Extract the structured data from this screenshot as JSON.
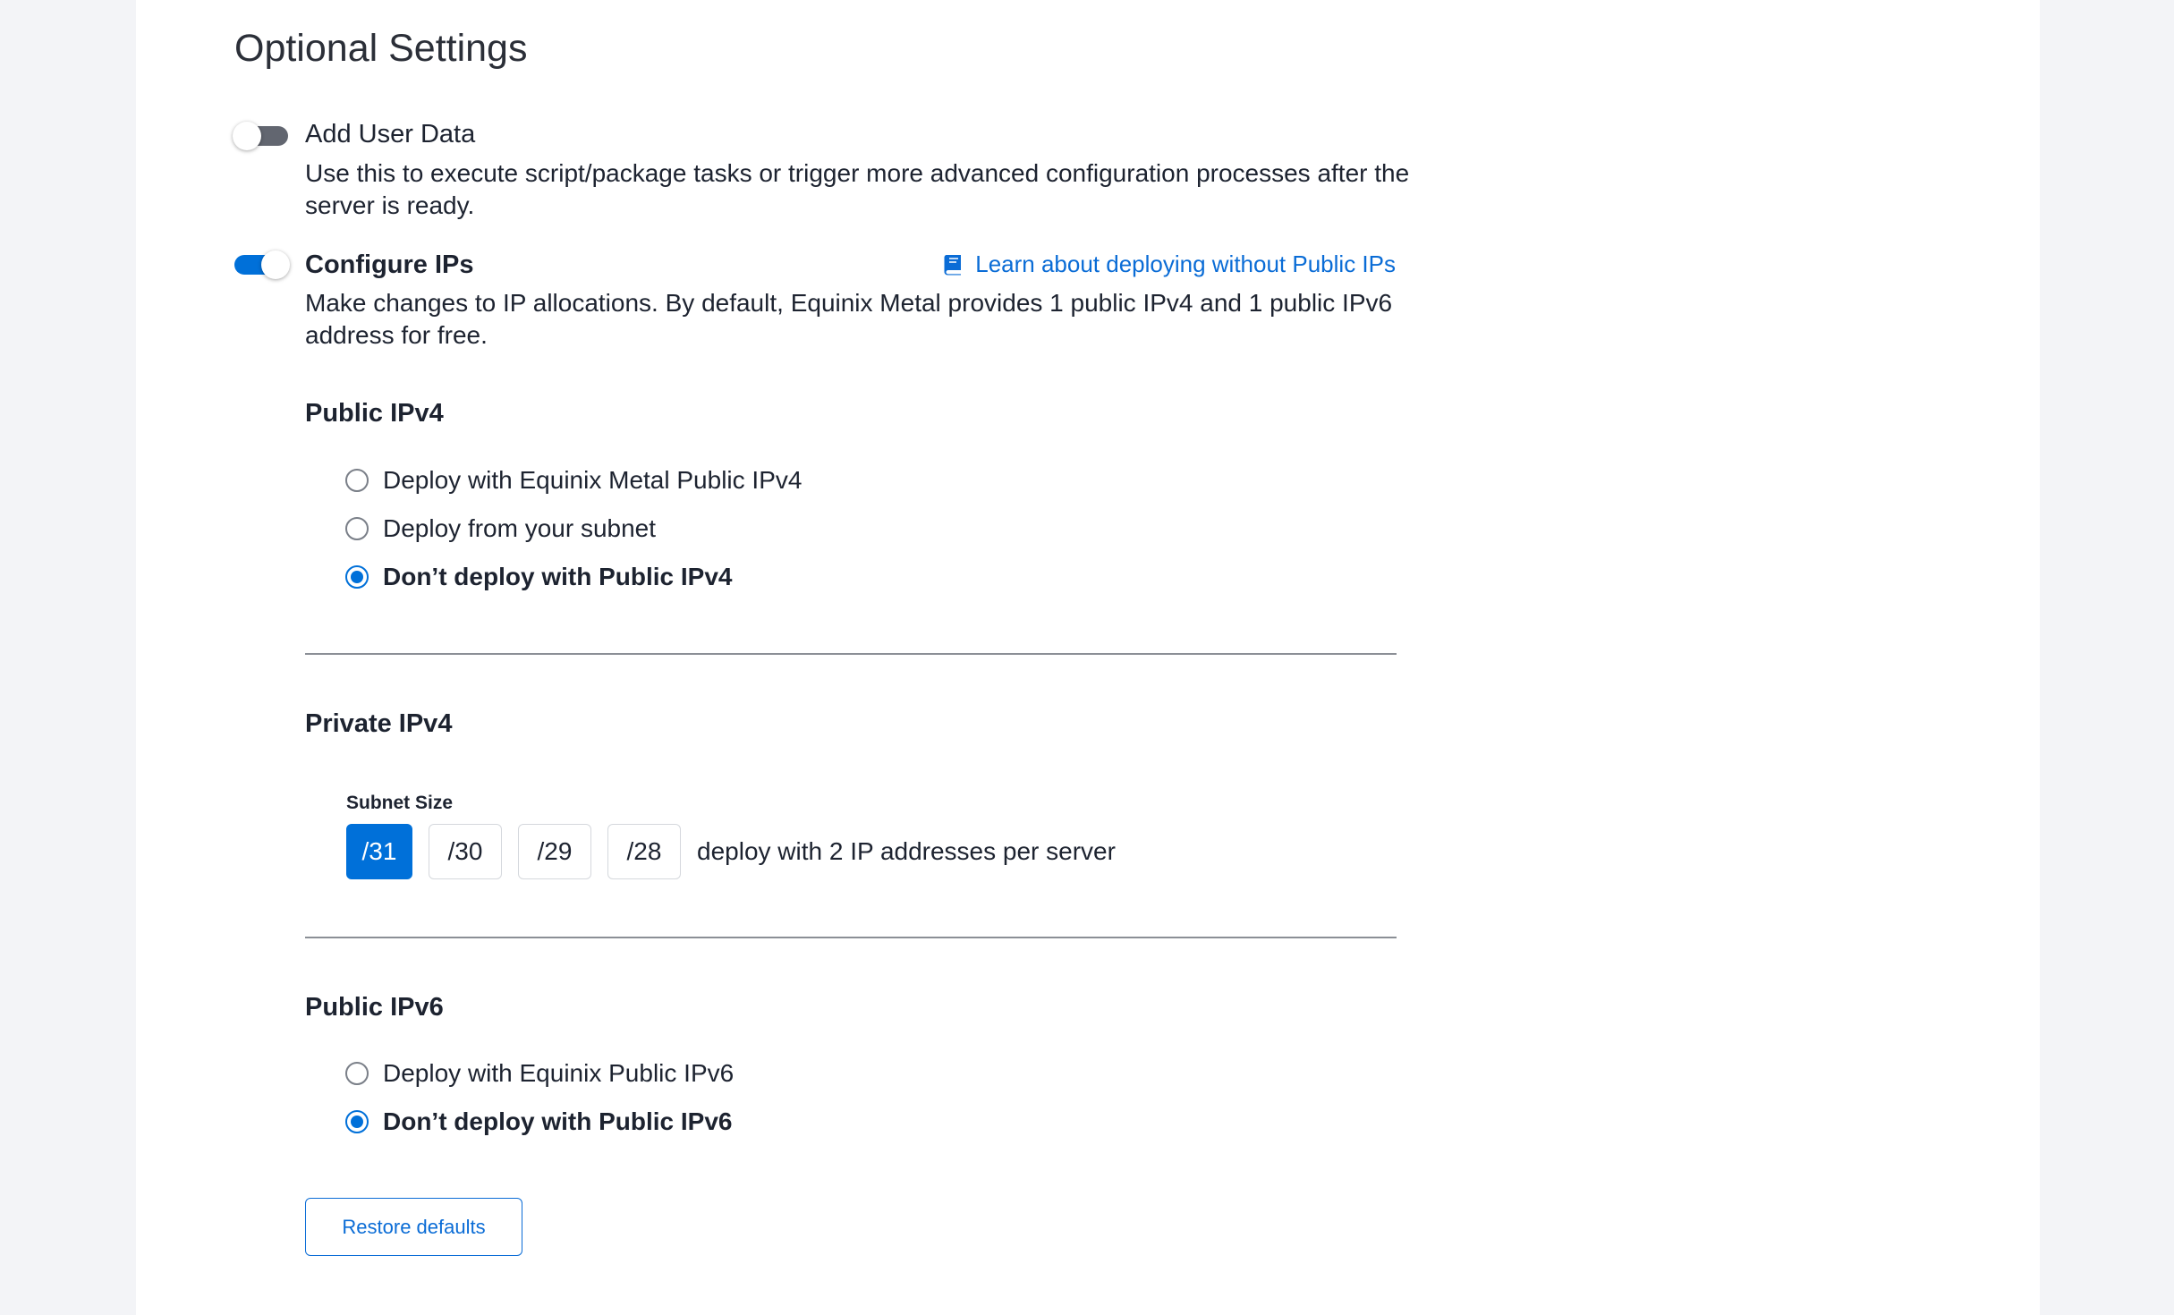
{
  "page": {
    "title": "Optional Settings"
  },
  "user_data": {
    "label": "Add User Data",
    "enabled": false,
    "description": "Use this to execute script/package tasks or trigger more advanced configuration processes after the server is ready."
  },
  "configure_ips": {
    "label": "Configure IPs",
    "enabled": true,
    "description": "Make changes to IP allocations. By default, Equinix Metal provides 1 public IPv4 and 1 public IPv6 address for free.",
    "learn_link": {
      "label": "Learn about deploying without Public IPs",
      "icon": "book-icon"
    }
  },
  "public_ipv4": {
    "title": "Public IPv4",
    "options": [
      {
        "label": "Deploy with Equinix Metal Public IPv4",
        "selected": false
      },
      {
        "label": "Deploy from your subnet",
        "selected": false
      },
      {
        "label": "Don’t deploy with Public IPv4",
        "selected": true
      }
    ]
  },
  "private_ipv4": {
    "title": "Private IPv4",
    "subnet_label": "Subnet Size",
    "sizes": [
      {
        "label": "/31",
        "selected": true
      },
      {
        "label": "/30",
        "selected": false
      },
      {
        "label": "/29",
        "selected": false
      },
      {
        "label": "/28",
        "selected": false
      }
    ],
    "note": "deploy with 2 IP addresses per server"
  },
  "public_ipv6": {
    "title": "Public IPv6",
    "options": [
      {
        "label": "Deploy with Equinix Public IPv6",
        "selected": false
      },
      {
        "label": "Don’t deploy with Public IPv6",
        "selected": true
      }
    ]
  },
  "actions": {
    "restore_label": "Restore defaults"
  },
  "colors": {
    "accent": "#0070d9",
    "link": "#0a6cd6",
    "toggle_off": "#626670",
    "background": "#f3f4f7"
  }
}
